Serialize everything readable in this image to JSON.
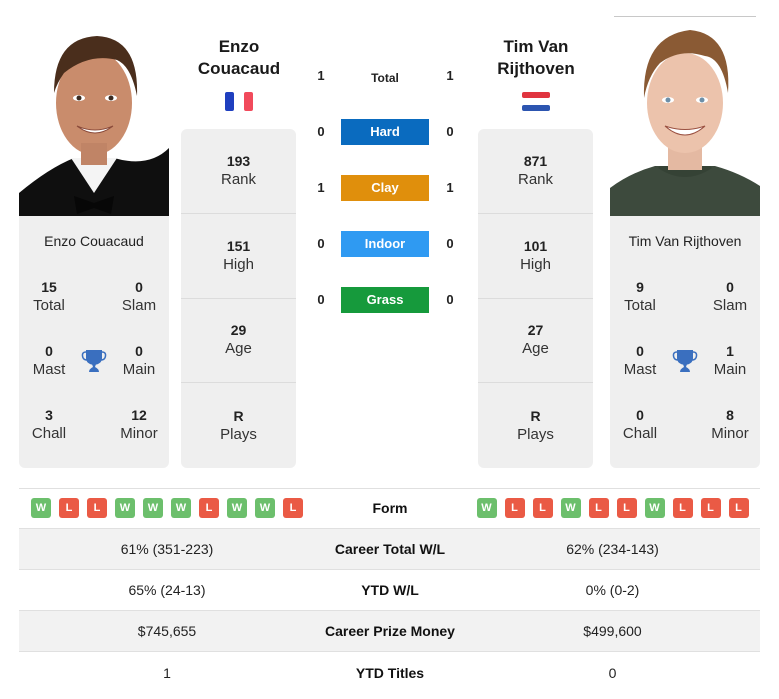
{
  "colors": {
    "hard": "#0a6bbf",
    "clay": "#e08f0c",
    "indoor": "#2f9af2",
    "grass": "#169a3c",
    "win": "#6cbf6c",
    "loss": "#ea5a45",
    "trophy": "#3a6fbf",
    "card_bg": "#efefef"
  },
  "player_left": {
    "name": "Enzo Couacaud",
    "name_line1": "Enzo",
    "name_line2": "Couacaud",
    "flag": "France",
    "flag_colors": [
      "#1f3fbf",
      "#ffffff",
      "#f14a5b"
    ],
    "stats": [
      {
        "value": "193",
        "label": "Rank"
      },
      {
        "value": "151",
        "label": "High"
      },
      {
        "value": "29",
        "label": "Age"
      },
      {
        "value": "R",
        "label": "Plays"
      }
    ],
    "titles": {
      "total": {
        "value": "15",
        "label": "Total"
      },
      "slam": {
        "value": "0",
        "label": "Slam"
      },
      "mast": {
        "value": "0",
        "label": "Mast"
      },
      "main": {
        "value": "0",
        "label": "Main"
      },
      "chall": {
        "value": "3",
        "label": "Chall"
      },
      "minor": {
        "value": "12",
        "label": "Minor"
      }
    }
  },
  "player_right": {
    "name": "Tim Van Rijthoven",
    "name_line1": "Tim Van",
    "name_line2": "Rijthoven",
    "flag": "Netherlands",
    "flag_colors": [
      "#e0343f",
      "#ffffff",
      "#2c55b0"
    ],
    "stats": [
      {
        "value": "871",
        "label": "Rank"
      },
      {
        "value": "101",
        "label": "High"
      },
      {
        "value": "27",
        "label": "Age"
      },
      {
        "value": "R",
        "label": "Plays"
      }
    ],
    "titles": {
      "total": {
        "value": "9",
        "label": "Total"
      },
      "slam": {
        "value": "0",
        "label": "Slam"
      },
      "mast": {
        "value": "0",
        "label": "Mast"
      },
      "main": {
        "value": "1",
        "label": "Main"
      },
      "chall": {
        "value": "0",
        "label": "Chall"
      },
      "minor": {
        "value": "8",
        "label": "Minor"
      }
    }
  },
  "h2h": [
    {
      "label": "Total",
      "left": "1",
      "right": "1",
      "surface": "total"
    },
    {
      "label": "Hard",
      "left": "0",
      "right": "0",
      "surface": "hard"
    },
    {
      "label": "Clay",
      "left": "1",
      "right": "1",
      "surface": "clay"
    },
    {
      "label": "Indoor",
      "left": "0",
      "right": "0",
      "surface": "indoor"
    },
    {
      "label": "Grass",
      "left": "0",
      "right": "0",
      "surface": "grass"
    }
  ],
  "form": {
    "label": "Form",
    "left": [
      "W",
      "L",
      "L",
      "W",
      "W",
      "W",
      "L",
      "W",
      "W",
      "L"
    ],
    "right": [
      "W",
      "L",
      "L",
      "W",
      "L",
      "L",
      "W",
      "L",
      "L",
      "L"
    ]
  },
  "comparison": [
    {
      "label": "Career Total W/L",
      "left": "61% (351-223)",
      "right": "62% (234-143)"
    },
    {
      "label": "YTD W/L",
      "left": "65% (24-13)",
      "right": "0% (0-2)"
    },
    {
      "label": "Career Prize Money",
      "left": "$745,655",
      "right": "$499,600"
    },
    {
      "label": "YTD Titles",
      "left": "1",
      "right": "0"
    }
  ]
}
